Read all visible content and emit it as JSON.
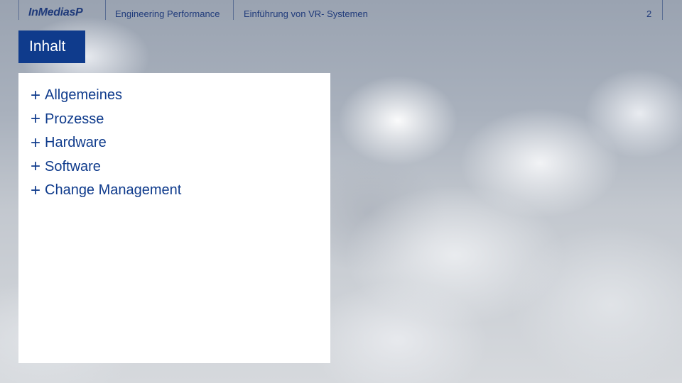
{
  "header": {
    "logo_text": "InMediasP",
    "section": "Engineering Performance",
    "subtitle": "Einführung von VR- Systemen",
    "page_number": "2"
  },
  "slide": {
    "title": "Inhalt",
    "items": [
      {
        "label": "Allgemeines"
      },
      {
        "label": "Prozesse"
      },
      {
        "label": "Hardware"
      },
      {
        "label": "Software"
      },
      {
        "label": "Change Management"
      }
    ],
    "bullet_symbol": "+"
  },
  "colors": {
    "brand_blue": "#0f3b8c",
    "text_blue": "#1f3a7a"
  }
}
